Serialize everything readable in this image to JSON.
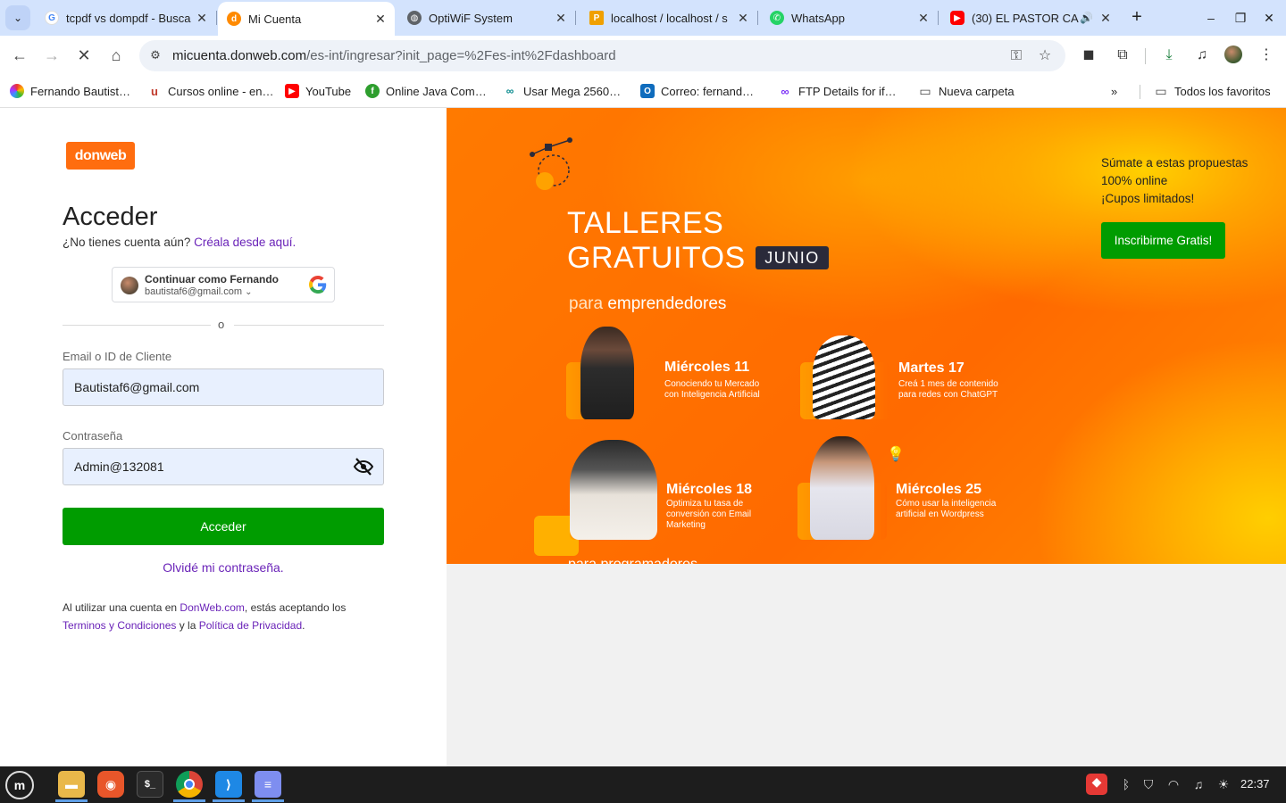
{
  "tabs": [
    {
      "title": "tcpdf vs dompdf - Busca",
      "favicon": "google-g-icon"
    },
    {
      "title": "Mi Cuenta",
      "favicon": "donweb-icon"
    },
    {
      "title": "OptiWiF System",
      "favicon": "globe-icon"
    },
    {
      "title": "localhost / localhost / s",
      "favicon": "phpmyadmin-icon"
    },
    {
      "title": "WhatsApp",
      "favicon": "whatsapp-icon"
    },
    {
      "title": "(30) EL PASTOR CA",
      "favicon": "youtube-icon"
    }
  ],
  "toolbar": {
    "url_host": "micuenta.donweb.com",
    "url_path": "/es-int/ingresar?init_page=%2Fes-int%2Fdashboard"
  },
  "bookmarks": [
    {
      "label": "Fernando Bautist…"
    },
    {
      "label": "Cursos online - en…"
    },
    {
      "label": "YouTube"
    },
    {
      "label": "Online Java Com…"
    },
    {
      "label": "Usar Mega 2560…"
    },
    {
      "label": "Correo: fernand…"
    },
    {
      "label": "FTP Details for if…"
    },
    {
      "label": "Nueva carpeta"
    }
  ],
  "bookmarks_all": "Todos los favoritos",
  "login": {
    "logo": "donweb",
    "heading": "Acceder",
    "no_account": "¿No tienes cuenta aún?",
    "signup_link": "Créala desde aquí.",
    "google_name": "Continuar como Fernando",
    "google_email": "bautistaf6@gmail.com",
    "or": "o",
    "email_label": "Email o ID de Cliente",
    "email_value": "Bautistaf6@gmail.com",
    "password_label": "Contraseña",
    "password_value": "Admin@132081",
    "submit": "Acceder",
    "forgot": "Olvidé mi contraseña.",
    "terms_prefix": "Al utilizar una cuenta en ",
    "terms_site": "DonWeb.com",
    "terms_mid": ", estás aceptando los ",
    "terms_link": "Terminos y Condiciones",
    "terms_and": " y la ",
    "privacy_link": "Política de Privacidad",
    "terms_end": "."
  },
  "banner": {
    "title_line1": "TALLERES",
    "title_line2": "GRATUITOS",
    "badge": "JUNIO",
    "subtitle_a": "para ",
    "subtitle_b": "emprendedores",
    "tagline1": "Súmate a estas propuestas",
    "tagline2": "100% online",
    "tagline3": "¡Cupos limitados!",
    "cta": "Inscribirme Gratis!",
    "cut_text": "para programadores",
    "sessions": [
      {
        "day": "Miércoles 11",
        "desc": "Conociendo tu Mercado con Inteligencia Artificial"
      },
      {
        "day": "Martes 17",
        "desc": "Creá 1 mes de contenido para redes con ChatGPT"
      },
      {
        "day": "Miércoles 18",
        "desc": "Optimiza tu tasa de conversión con Email Marketing"
      },
      {
        "day": "Miércoles 25",
        "desc": "Cómo usar la inteligencia artificial en Wordpress"
      }
    ]
  },
  "taskbar": {
    "clock": "22:37"
  },
  "colors": {
    "brand_orange": "#ff6d0f",
    "cta_green": "#009c00",
    "link_purple": "#6a23b8"
  }
}
